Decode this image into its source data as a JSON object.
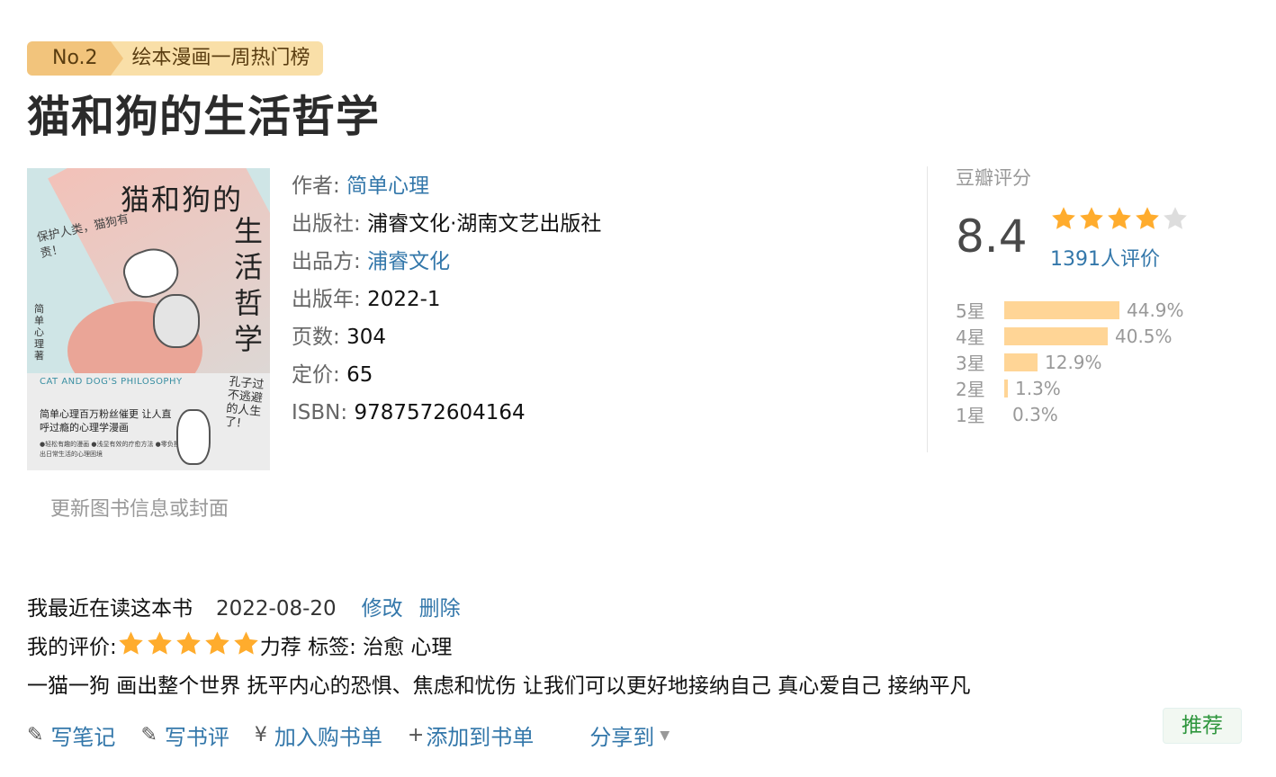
{
  "badge": {
    "rank": "No.2",
    "list_name": "绘本漫画一周热门榜"
  },
  "book": {
    "title": "猫和狗的生活哲学",
    "info": [
      {
        "label": "作者:",
        "value": "简单心理",
        "link": true
      },
      {
        "label": "出版社:",
        "value": "浦睿文化·湖南文艺出版社",
        "link": false
      },
      {
        "label": "出品方:",
        "value": "浦睿文化",
        "link": true
      },
      {
        "label": "出版年:",
        "value": "2022-1",
        "link": false
      },
      {
        "label": "页数:",
        "value": "304",
        "link": false
      },
      {
        "label": "定价:",
        "value": "65",
        "link": false
      },
      {
        "label": "ISBN:",
        "value": "9787572604164",
        "link": false
      }
    ],
    "update_link": "更新图书信息或封面"
  },
  "cover": {
    "title_horizontal": "猫和狗的",
    "title_vertical": "生活哲学",
    "handwriting": "保护人类，猫狗有责！",
    "author": "简单心理著",
    "english": "CAT AND DOG'S PHILOSOPHY",
    "slogan": "简单心理百万粉丝催更 让人直呼过瘾的心理学漫画",
    "bullets": "●轻松有趣的漫画 ●浅显有效的疗愈方法 ●零负担带你走出日常生活的心理困境",
    "handwriting2": "孔子过不逃避的人生了!"
  },
  "rating": {
    "label": "豆瓣评分",
    "score": "8.4",
    "stars_filled": 4,
    "stars_total": 5,
    "count_text": "1391人评价",
    "distribution": [
      {
        "label": "5星",
        "percent": 44.9,
        "percent_text": "44.9%"
      },
      {
        "label": "4星",
        "percent": 40.5,
        "percent_text": "40.5%"
      },
      {
        "label": "3星",
        "percent": 12.9,
        "percent_text": "12.9%"
      },
      {
        "label": "2星",
        "percent": 1.3,
        "percent_text": "1.3%"
      },
      {
        "label": "1星",
        "percent": 0.3,
        "percent_text": "0.3%"
      }
    ],
    "star_color": "#ffac2d",
    "bar_color": "#ffd596"
  },
  "mine": {
    "status": "我最近在读这本书",
    "date": "2022-08-20",
    "edit": "修改",
    "delete": "删除",
    "rating_label": "我的评价:",
    "my_stars": 5,
    "rating_word": "力荐",
    "tags_label": "标签:",
    "tags": "治愈 心理",
    "comment": "一猫一狗 画出整个世界 抚平内心的恐惧、焦虑和忧伤 让我们可以更好地接纳自己 真心爱自己 接纳平凡"
  },
  "actions": {
    "write_note": "写笔记",
    "write_review": "写书评",
    "add_to_cart": "加入购书单",
    "add_to_list": "添加到书单",
    "share": "分享到",
    "recommend": "推荐"
  },
  "colors": {
    "link": "#3377aa",
    "recommend_green": "#2e963d"
  }
}
